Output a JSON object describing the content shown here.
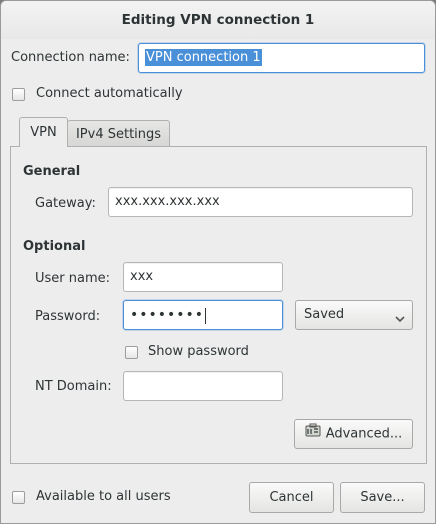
{
  "window": {
    "title": "Editing VPN connection 1"
  },
  "connection": {
    "name_label": "Connection name:",
    "name_value": "VPN connection 1",
    "auto_connect_label": "Connect automatically",
    "auto_connect_checked": false
  },
  "tabs": [
    {
      "label": "VPN",
      "active": true
    },
    {
      "label": "IPv4 Settings",
      "active": false
    }
  ],
  "general": {
    "title": "General",
    "gateway_label": "Gateway:",
    "gateway_value": "xxx.xxx.xxx.xxx"
  },
  "optional": {
    "title": "Optional",
    "username_label": "User name:",
    "username_value": "xxx",
    "password_label": "Password:",
    "password_masked": "••••••••",
    "password_storage": "Saved",
    "show_password_label": "Show password",
    "show_password_checked": false,
    "nt_domain_label": "NT Domain:",
    "nt_domain_value": ""
  },
  "buttons": {
    "advanced_label": "Advanced...",
    "cancel_label": "Cancel",
    "save_label": "Save..."
  },
  "footer": {
    "all_users_label": "Available to all users",
    "all_users_checked": false
  },
  "icons": {
    "advanced_icon": "toolbox-icon",
    "combo_arrow": "chevron-down-icon"
  }
}
